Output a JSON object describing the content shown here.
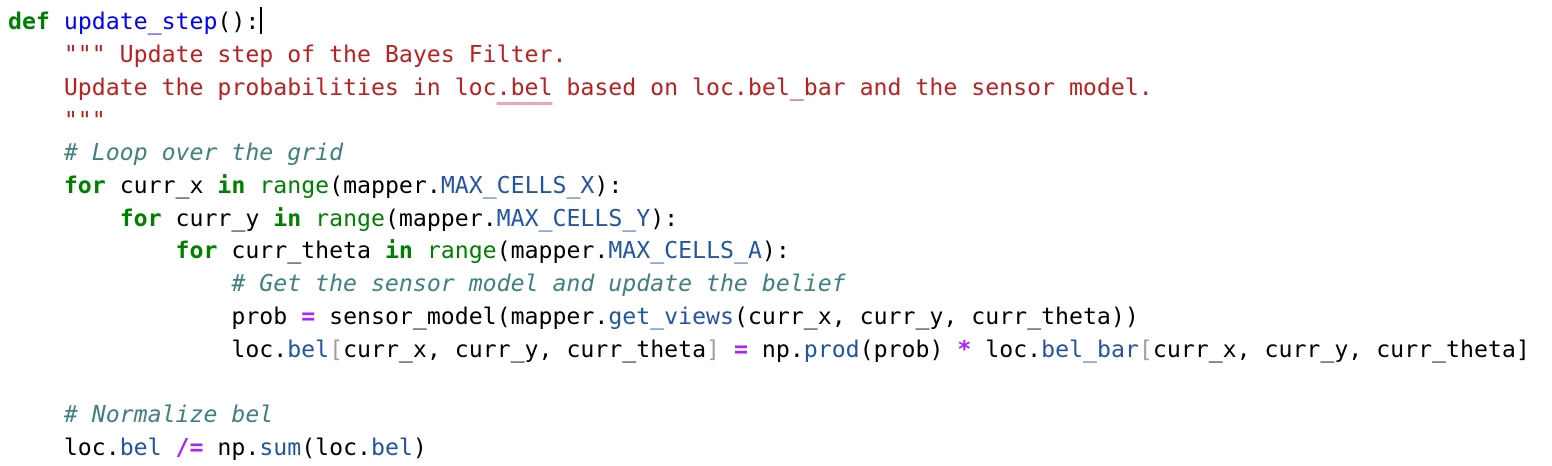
{
  "code": {
    "language": "python",
    "line_1": {
      "kw_def": "def",
      "space": " ",
      "func_name": "update_step",
      "signature": "():"
    },
    "line_2": {
      "indent": "    ",
      "docstring": "\"\"\" Update step of the Bayes Filter."
    },
    "line_3": {
      "indent": "    ",
      "doc_before": "Update the probabilities in loc",
      "doc_flagged": ".bel",
      "doc_after": " based on loc.bel_bar and the sensor model."
    },
    "line_4": {
      "indent": "    ",
      "docstring_end": "\"\"\""
    },
    "line_5": {
      "indent": "    ",
      "comment": "# Loop over the grid"
    },
    "line_6": {
      "indent": "    ",
      "kw_for": "for",
      "var": " curr_x ",
      "kw_in": "in",
      "sp": " ",
      "builtin": "range",
      "open": "(mapper.",
      "attr": "MAX_CELLS_X",
      "close": "):"
    },
    "line_7": {
      "indent": "        ",
      "kw_for": "for",
      "var": " curr_y ",
      "kw_in": "in",
      "sp": " ",
      "builtin": "range",
      "open": "(mapper.",
      "attr": "MAX_CELLS_Y",
      "close": "):"
    },
    "line_8": {
      "indent": "            ",
      "kw_for": "for",
      "var": " curr_theta ",
      "kw_in": "in",
      "sp": " ",
      "builtin": "range",
      "open": "(mapper.",
      "attr": "MAX_CELLS_A",
      "close": "):"
    },
    "line_9": {
      "indent": "                ",
      "comment": "# Get the sensor model and update the belief"
    },
    "line_10": {
      "indent": "                ",
      "lhs": "prob ",
      "op": "=",
      "call_start": " sensor_model(mapper.",
      "method": "get_views",
      "args": "(curr_x, curr_y, curr_theta))"
    },
    "line_11": {
      "indent": "                ",
      "obj": "loc.",
      "attr_bel": "bel",
      "bracket_open": "[",
      "idx1": "curr_x, curr_y, curr_theta",
      "bracket_close": "]",
      "sp1": " ",
      "op_assign": "=",
      "np_prefix": " np.",
      "func_prod": "prod",
      "prod_args": "(prob) ",
      "op_mul": "*",
      "rhs_obj": " loc.",
      "attr_bel_bar": "bel_bar",
      "bracket_open2": "[",
      "idx2": "curr_x, curr_y, curr_theta",
      "bracket_close2": "]"
    },
    "line_13": {
      "indent": "    ",
      "comment": "# Normalize bel"
    },
    "line_14": {
      "indent": "    ",
      "obj": "loc.",
      "attr_bel": "bel",
      "sp": " ",
      "op": "/=",
      "np_prefix": " np.",
      "func_sum": "sum",
      "args_start": "(loc.",
      "attr_bel2": "bel",
      "args_end": ")"
    }
  },
  "colors": {
    "background": "#ffffff",
    "keyword": "#008000",
    "function_name": "#0000ff",
    "docstring": "#ba2121",
    "comment": "#408080",
    "operator": "#aa22ff",
    "attribute": "#2455a4",
    "faded_bracket": "#a0a0a0",
    "spellcheck_underline": "#f2a4b2"
  }
}
